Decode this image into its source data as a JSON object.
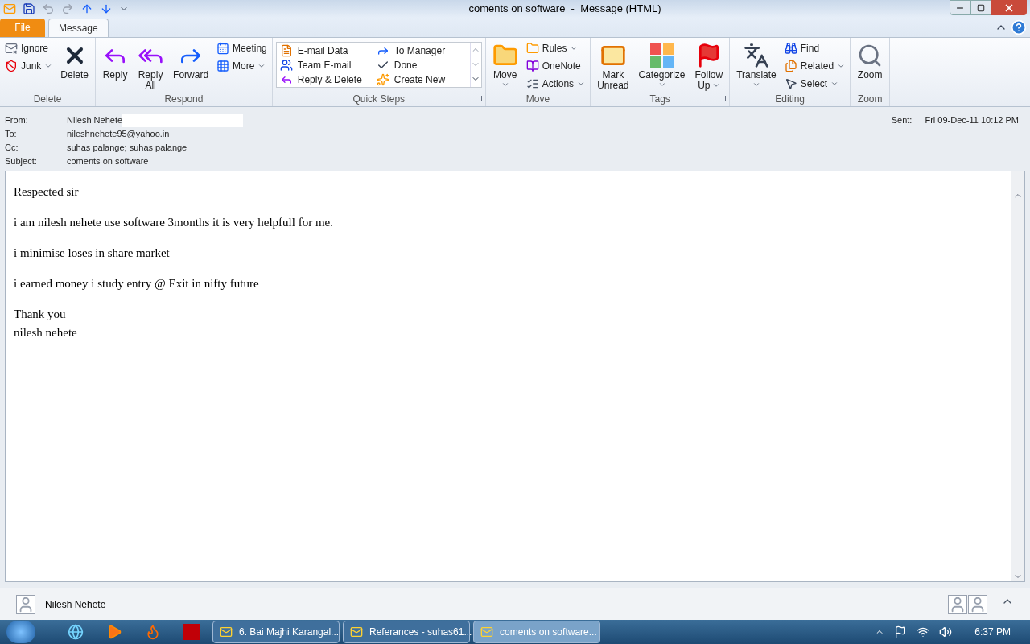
{
  "window": {
    "title": "coments on software  -  Message (HTML)"
  },
  "tabs": [
    {
      "label": "File",
      "kind": "file",
      "selected": false
    },
    {
      "label": "Message",
      "kind": "tab",
      "selected": true
    }
  ],
  "ribbon": [
    {
      "label": "Delete",
      "columns": [
        {
          "kind": "stack",
          "items": [
            {
              "label": "Ignore",
              "dropdown": false
            },
            {
              "label": "Junk",
              "dropdown": true
            }
          ]
        },
        {
          "kind": "large",
          "items": [
            {
              "lines": [
                "Delete"
              ],
              "dropdown": false
            }
          ]
        }
      ]
    },
    {
      "label": "Respond",
      "columns": [
        {
          "kind": "large",
          "items": [
            {
              "lines": [
                "Reply"
              ],
              "dropdown": false
            }
          ]
        },
        {
          "kind": "large",
          "items": [
            {
              "lines": [
                "Reply",
                "All"
              ],
              "dropdown": false
            }
          ]
        },
        {
          "kind": "large",
          "items": [
            {
              "lines": [
                "Forward"
              ],
              "dropdown": false
            }
          ]
        },
        {
          "kind": "stack",
          "items": [
            {
              "label": "Meeting",
              "dropdown": false
            },
            {
              "label": "More",
              "dropdown": true
            }
          ]
        }
      ]
    },
    {
      "label": "Quick Steps",
      "launcher": true,
      "columns": [
        {
          "kind": "gallery",
          "items": [
            {
              "label": "E-mail Data"
            },
            {
              "label": "To Manager"
            },
            {
              "label": "Team E-mail"
            },
            {
              "label": "Done"
            },
            {
              "label": "Reply & Delete"
            },
            {
              "label": "Create New"
            }
          ]
        }
      ]
    },
    {
      "label": "Move",
      "columns": [
        {
          "kind": "large",
          "items": [
            {
              "lines": [
                "Move"
              ],
              "dropdown": true
            }
          ]
        },
        {
          "kind": "stack",
          "items": [
            {
              "label": "Rules",
              "dropdown": true
            },
            {
              "label": "OneNote",
              "dropdown": false
            },
            {
              "label": "Actions",
              "dropdown": true
            }
          ]
        }
      ]
    },
    {
      "label": "Tags",
      "launcher": true,
      "columns": [
        {
          "kind": "large",
          "items": [
            {
              "lines": [
                "Mark",
                "Unread"
              ],
              "dropdown": false
            }
          ]
        },
        {
          "kind": "large",
          "items": [
            {
              "lines": [
                "Categorize"
              ],
              "dropdown": true
            }
          ]
        },
        {
          "kind": "large",
          "items": [
            {
              "lines": [
                "Follow",
                "Up"
              ],
              "dropdown": true
            }
          ]
        }
      ]
    },
    {
      "label": "Editing",
      "columns": [
        {
          "kind": "large",
          "items": [
            {
              "lines": [
                "Translate"
              ],
              "dropdown": true
            }
          ]
        },
        {
          "kind": "stack",
          "items": [
            {
              "label": "Find",
              "dropdown": false
            },
            {
              "label": "Related",
              "dropdown": true
            },
            {
              "label": "Select",
              "dropdown": true
            }
          ]
        }
      ]
    },
    {
      "label": "Zoom",
      "columns": [
        {
          "kind": "large",
          "items": [
            {
              "lines": [
                "Zoom"
              ],
              "dropdown": false
            }
          ]
        }
      ]
    }
  ],
  "header": {
    "fields": [
      {
        "label": "From:",
        "value": "Nilesh Nehete"
      },
      {
        "label": "To:",
        "value": "nileshnehete95@yahoo.in"
      },
      {
        "label": "Cc:",
        "value": "suhas palange; suhas palange"
      },
      {
        "label": "Subject:",
        "value": "coments on software"
      }
    ],
    "sent_label": "Sent:",
    "sent_value": "Fri 09-Dec-11 10:12 PM"
  },
  "body": [
    "Respected sir",
    "i am nilesh nehete use software 3months it is very helpfull for me.",
    "i minimise loses in share market",
    "i earned money i study entry @ Exit in nifty future",
    "Thank you",
    "nilesh nehete"
  ],
  "people_pane": {
    "name": "Nilesh Nehete"
  },
  "taskbar": {
    "tasks": [
      {
        "label": "6. Bai Majhi Karangal...",
        "selected": false
      },
      {
        "label": "Referances - suhas61...",
        "selected": false
      },
      {
        "label": "coments on software...",
        "selected": true
      }
    ],
    "clock": "6:37 PM"
  }
}
